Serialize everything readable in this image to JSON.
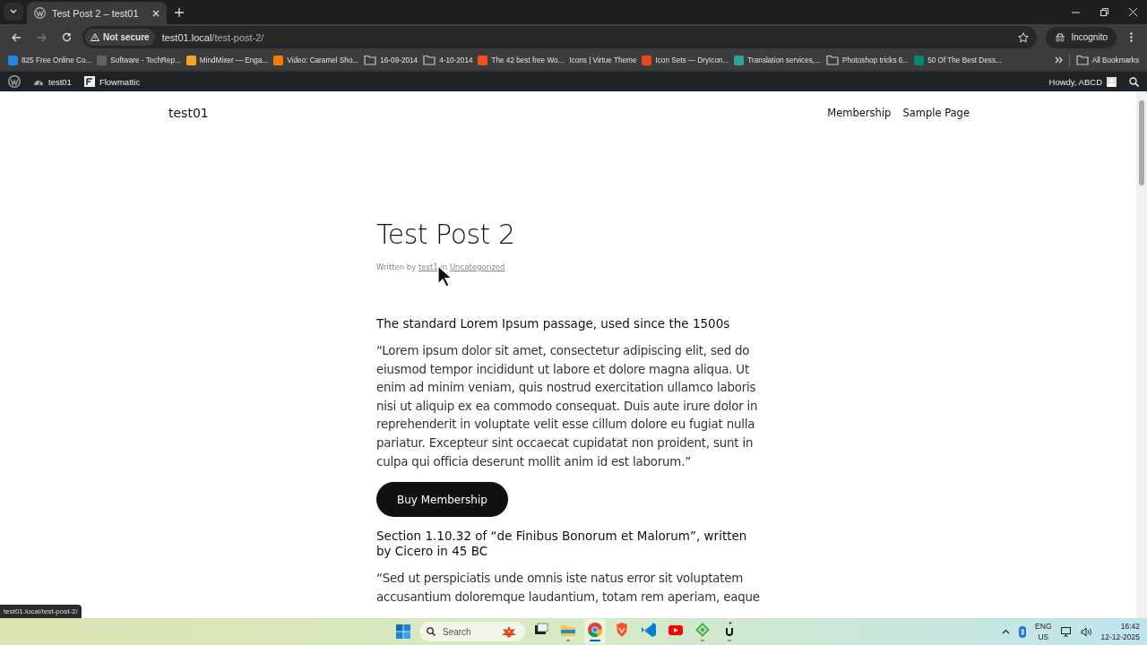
{
  "browser": {
    "tabs": [
      {
        "title": "Test Post 2 – test01",
        "selected": true
      }
    ],
    "security": "Not secure",
    "url_host": "test01.local",
    "url_path": "/test-post-2/",
    "profile": "Incognito",
    "bookmarks": [
      {
        "label": "825 Free Online Co...",
        "kind": "site",
        "color": "#1e88e5"
      },
      {
        "label": "Software - TechRep...",
        "kind": "site",
        "color": "#5f6368"
      },
      {
        "label": "MindMixer — Enga...",
        "kind": "site",
        "color": "#f5a623"
      },
      {
        "label": "Video: Caramel Sho...",
        "kind": "site",
        "color": "#f57c00"
      },
      {
        "label": "16-09-2014",
        "kind": "folder"
      },
      {
        "label": "4-10-2014",
        "kind": "folder"
      },
      {
        "label": "The 42 best free Wo...",
        "kind": "site",
        "color": "#f4511e"
      },
      {
        "label": "Icons | Virtue Theme",
        "kind": "plain"
      },
      {
        "label": "Icon Sets — DryIcon...",
        "kind": "site",
        "color": "#e64a19"
      },
      {
        "label": "Translation services,...",
        "kind": "site",
        "color": "#26a69a"
      },
      {
        "label": "Photoshop tricks  6...",
        "kind": "folder"
      },
      {
        "label": "50 Of The Best Dess...",
        "kind": "site",
        "color": "#00897b"
      }
    ],
    "all_bookmarks": "All Bookmarks",
    "status_link": "test01.local/test-post-2/"
  },
  "admin_bar": {
    "items": [
      "test01",
      "Flowmattic"
    ],
    "greeting": "Howdy, ABCD"
  },
  "site": {
    "title": "test01",
    "nav": [
      {
        "label": "Membership"
      },
      {
        "label": "Sample Page"
      }
    ]
  },
  "post": {
    "title": "Test Post 2",
    "meta": {
      "prefix": "Written by",
      "author": "test1",
      "joiner": "in",
      "category": "Uncategorized"
    },
    "blocks": [
      {
        "kind": "heading",
        "text": "The standard Lorem Ipsum passage, used since the 1500s"
      },
      {
        "kind": "paragraph",
        "text": "“Lorem ipsum dolor sit amet, consectetur adipiscing elit, sed do eiusmod tempor incididunt ut labore et dolore magna aliqua. Ut enim ad minim veniam, quis nostrud exercitation ullamco laboris nisi ut aliquip ex ea commodo consequat. Duis aute irure dolor in reprehenderit in voluptate velit esse cillum dolore eu fugiat nulla pariatur. Excepteur sint occaecat cupidatat non proident, sunt in culpa qui officia deserunt mollit anim id est laborum.”"
      },
      {
        "kind": "button",
        "text": "Buy Membership"
      },
      {
        "kind": "heading",
        "text": "Section 1.10.32 of “de Finibus Bonorum et Malorum”, written by Cicero in 45 BC"
      },
      {
        "kind": "paragraph",
        "text": "“Sed ut perspiciatis unde omnis iste natus error sit voluptatem accusantium doloremque laudantium, totam rem aperiam, eaque"
      }
    ]
  },
  "taskbar": {
    "search_placeholder": "Search",
    "apps": [
      {
        "kind": "task-view",
        "running": false,
        "selected": false
      },
      {
        "kind": "folder",
        "running": true,
        "selected": false
      },
      {
        "kind": "browser",
        "running": true,
        "selected": true
      },
      {
        "kind": "shield",
        "running": false,
        "selected": false
      },
      {
        "kind": "code",
        "running": false,
        "selected": false
      },
      {
        "kind": "video",
        "running": false,
        "selected": false
      },
      {
        "kind": "diamond",
        "running": true,
        "selected": false
      },
      {
        "kind": "glyph",
        "running": true,
        "selected": false
      }
    ],
    "language": "ENG",
    "region": "US",
    "time": "16:42",
    "date": "12-12-2025"
  }
}
